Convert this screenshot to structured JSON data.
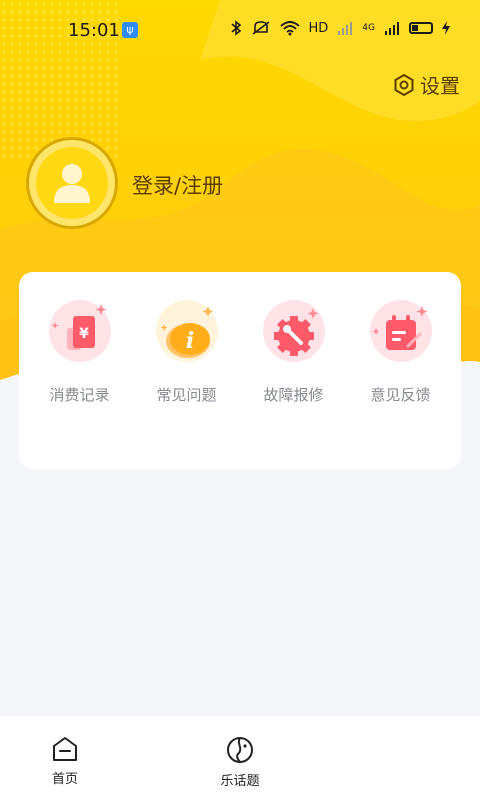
{
  "status_bar": {
    "time": "15:01",
    "network_label": "HD",
    "signal_label": "4G"
  },
  "header": {
    "settings_label": "设置",
    "login_label": "登录/注册"
  },
  "menu": {
    "items": [
      {
        "label": "消费记录",
        "icon": "receipt-yen-icon"
      },
      {
        "label": "常见问题",
        "icon": "info-bubble-icon"
      },
      {
        "label": "故障报修",
        "icon": "wrench-gear-icon"
      },
      {
        "label": "意见反馈",
        "icon": "feedback-note-icon"
      }
    ]
  },
  "tabbar": {
    "tabs": [
      {
        "label": "首页",
        "icon": "home-icon"
      },
      {
        "label": "乐话题",
        "icon": "topic-face-icon"
      }
    ]
  },
  "colors": {
    "hero_yellow": "#ffd200",
    "accent_brown": "#5a3e00",
    "icon_pink": "#ff5a6a",
    "icon_orange": "#ffae1a"
  }
}
